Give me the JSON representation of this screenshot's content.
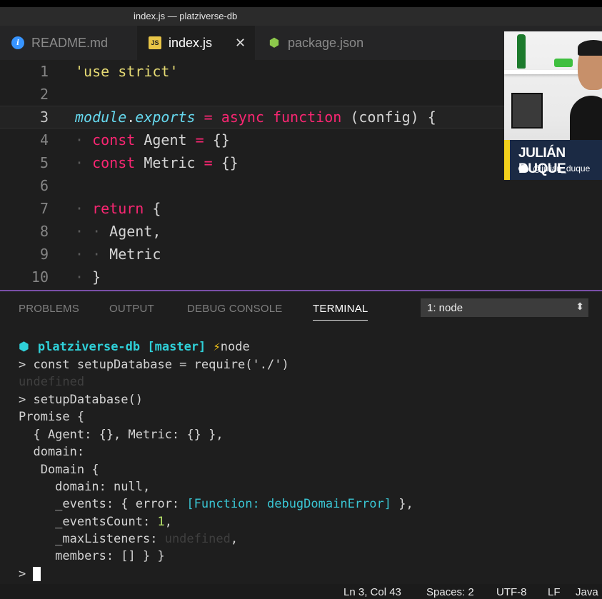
{
  "window": {
    "title": "index.js — platziverse-db"
  },
  "tabs": [
    {
      "label": "README.md",
      "icon": "info-icon"
    },
    {
      "label": "index.js",
      "icon": "js-icon",
      "icon_text": "JS",
      "close": "✕"
    },
    {
      "label": "package.json",
      "icon": "node-icon",
      "icon_text": "⬢"
    }
  ],
  "editor": {
    "line_numbers": [
      "1",
      "2",
      "3",
      "4",
      "5",
      "6",
      "7",
      "8",
      "9",
      "10"
    ],
    "lines": {
      "l1": "'use strict'",
      "l3_obj": "module",
      "l3_dot": ".",
      "l3_prop": "exports",
      "l3_eq": " = ",
      "l3_async": "async",
      "l3_function": " function",
      "l3_rest": " (config) {",
      "l4_kw": "const",
      "l4_rest": " Agent ",
      "l4_eq": "=",
      "l4_end": " {}",
      "l5_kw": "const",
      "l5_rest": " Metric ",
      "l5_eq": "=",
      "l5_end": " {}",
      "l7_kw": "return",
      "l7_rest": " {",
      "l8": "Agent,",
      "l9": "Metric",
      "l10": "}"
    }
  },
  "webcam": {
    "name": "JULIÁN DUQUE",
    "handle": "@julian_duque"
  },
  "panel": {
    "tabs": [
      "PROBLEMS",
      "OUTPUT",
      "DEBUG CONSOLE",
      "TERMINAL"
    ],
    "active_tab": "TERMINAL",
    "terminal_select": "1: node",
    "select_arrow": "⬍"
  },
  "terminal": {
    "hex": "⬢",
    "prompt_dir": "platziverse-db",
    "prompt_branch": "[master]",
    "prompt_bolt": "⚡",
    "prompt_cmd": "node",
    "lines": {
      "t1": "> const setupDatabase = require('./')",
      "t2": "undefined",
      "t3": "> setupDatabase()",
      "t4": "Promise {",
      "t5": "  { Agent: {}, Metric: {} },",
      "t6": "  domain:",
      "t7": "   Domain {",
      "t8": "     domain: null,",
      "t9_a": "     _events: { error: ",
      "t9_b": "[Function: debugDomainError]",
      "t9_c": " },",
      "t10_a": "     _eventsCount: ",
      "t10_b": "1",
      "t10_c": ",",
      "t11_a": "     _maxListeners: ",
      "t11_b": "undefined",
      "t11_c": ",",
      "t12": "     members: [] } }",
      "t13": ">"
    }
  },
  "statusbar": {
    "position": "Ln 3, Col 43",
    "spaces": "Spaces: 2",
    "encoding": "UTF-8",
    "eol": "LF",
    "language": "Java"
  }
}
